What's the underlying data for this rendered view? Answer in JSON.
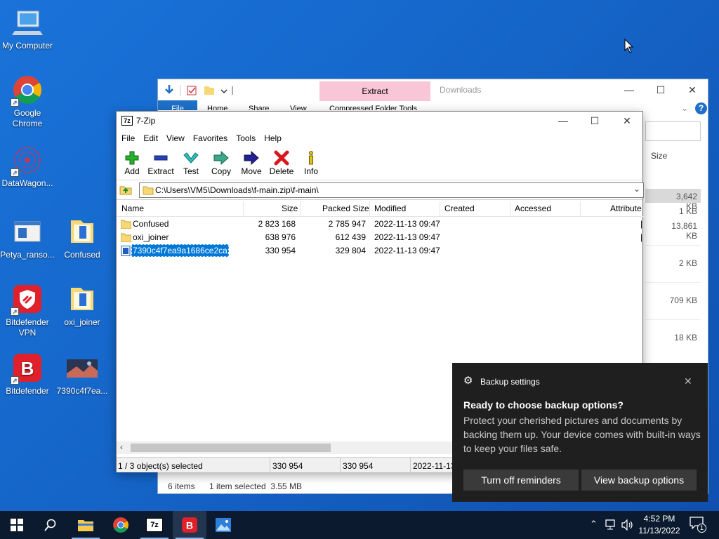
{
  "desktop": {
    "icons": [
      {
        "label": "My Computer"
      },
      {
        "label": "Google Chrome"
      },
      {
        "label": "DataWagon..."
      },
      {
        "label": "Petya_ranso..."
      },
      {
        "label": "Confused"
      },
      {
        "label": "Bitdefender VPN"
      },
      {
        "label": "oxi_joiner"
      },
      {
        "label": "Bitdefender"
      },
      {
        "label": "7390c4f7ea..."
      }
    ]
  },
  "explorer": {
    "title": "Downloads",
    "contextual_tab": "Extract",
    "contextual_group": "Compressed Folder Tools",
    "tabs": [
      "File",
      "Home",
      "Share",
      "View"
    ],
    "sizes": [
      "Size",
      "3,642 KB",
      "1 KB",
      "13,861 KB",
      "2 KB",
      "709 KB",
      "18 KB"
    ],
    "status_items": "6 items",
    "status_selected": "1 item selected  3.55 MB"
  },
  "sevenzip": {
    "title": "7-Zip",
    "app_badge": "7z",
    "menu": [
      "File",
      "Edit",
      "View",
      "Favorites",
      "Tools",
      "Help"
    ],
    "toolbar": [
      "Add",
      "Extract",
      "Test",
      "Copy",
      "Move",
      "Delete",
      "Info"
    ],
    "address": "C:\\Users\\VM5\\Downloads\\f-main.zip\\f-main\\",
    "columns": [
      "Name",
      "Size",
      "Packed Size",
      "Modified",
      "Created",
      "Accessed",
      "Attribute"
    ],
    "rows": [
      {
        "name": "Confused",
        "size": "2 823 168",
        "packed": "2 785 947",
        "modified": "2022-11-13 09:47",
        "type": "folder"
      },
      {
        "name": "oxi_joiner",
        "size": "638 976",
        "packed": "612 439",
        "modified": "2022-11-13 09:47",
        "type": "folder"
      },
      {
        "name": "7390c4f7ea9a1686ce2ca...",
        "size": "330 954",
        "packed": "329 804",
        "modified": "2022-11-13 09:47",
        "type": "file"
      }
    ],
    "status": {
      "selected": "1 / 3 object(s) selected",
      "size": "330 954",
      "packed": "330 954",
      "modified": "2022-11-13"
    }
  },
  "toast": {
    "app": "Backup settings",
    "heading": "Ready to choose backup options?",
    "body": "Protect your cherished pictures and documents by backing them up. Your device comes with built-in ways to keep your files safe.",
    "btn_off": "Turn off reminders",
    "btn_view": "View backup options"
  },
  "taskbar": {
    "time": "4:52 PM",
    "date": "11/13/2022",
    "notif_count": "1",
    "app_7z": "7z"
  },
  "colors": {
    "selection": "#0078d7",
    "toast_bg": "#1f1f1f",
    "extract_tab": "#f9c6d8",
    "taskbar": "#0b1a2e"
  }
}
